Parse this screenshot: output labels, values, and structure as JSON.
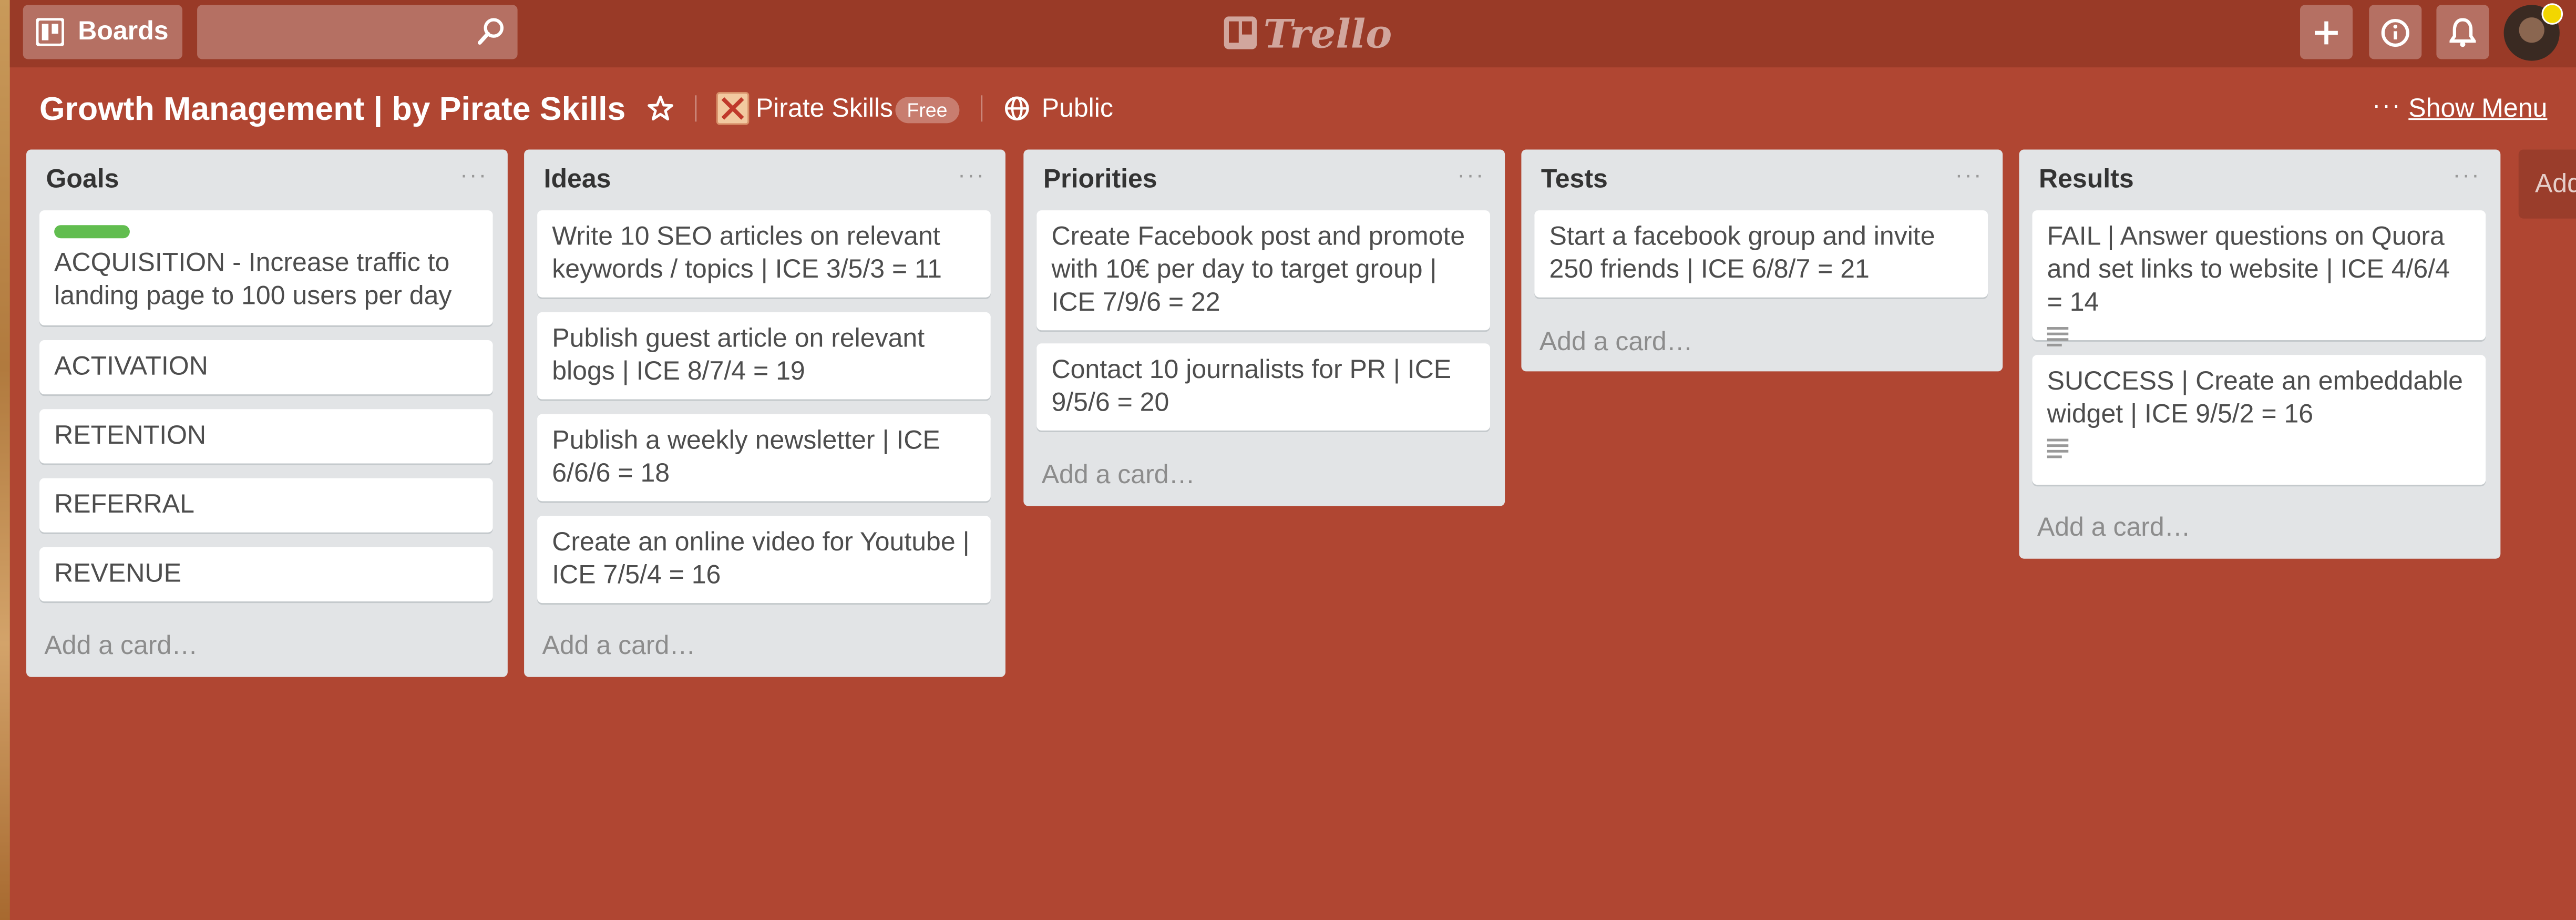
{
  "header": {
    "boards_label": "Boards",
    "search_placeholder": "",
    "logo_text": "Trello"
  },
  "board": {
    "title": "Growth Management | by Pirate Skills",
    "team": "Pirate Skills",
    "team_badge": "Free",
    "visibility": "Public",
    "menu_dots": "···",
    "show_menu": "Show Menu",
    "add_list": "Add"
  },
  "lists": [
    {
      "title": "Goals",
      "cards": [
        {
          "text": "ACQUISITION - Increase traffic to landing page to 100 users per day",
          "label_color": "#61bd4f"
        },
        {
          "text": "ACTIVATION"
        },
        {
          "text": "RETENTION"
        },
        {
          "text": "REFERRAL"
        },
        {
          "text": "REVENUE"
        }
      ],
      "add_card": "Add a card…"
    },
    {
      "title": "Ideas",
      "cards": [
        {
          "text": "Write 10 SEO articles on relevant keywords / topics | ICE 3/5/3 = 11"
        },
        {
          "text": "Publish guest article on relevant blogs | ICE 8/7/4 = 19"
        },
        {
          "text": "Publish a weekly newsletter | ICE 6/6/6 = 18"
        },
        {
          "text": "Create an online video for Youtube | ICE 7/5/4 = 16"
        }
      ],
      "add_card": "Add a card…"
    },
    {
      "title": "Priorities",
      "cards": [
        {
          "text": "Create Facebook post and promote with 10€ per day to target group | ICE 7/9/6 = 22"
        },
        {
          "text": "Contact 10 journalists for PR | ICE 9/5/6 = 20"
        }
      ],
      "add_card": "Add a card…"
    },
    {
      "title": "Tests",
      "cards": [
        {
          "text": "Start a facebook group and invite 250 friends | ICE 6/8/7 = 21"
        }
      ],
      "add_card": "Add a card…"
    },
    {
      "title": "Results",
      "cards": [
        {
          "text": "FAIL | Answer questions on Quora and set links to website | ICE 4/6/4 = 14",
          "has_description": true
        },
        {
          "text": "SUCCESS | Create an embeddable widget | ICE 9/5/2 = 16",
          "has_description": true
        }
      ],
      "add_card": "Add a card…"
    }
  ],
  "list_menu_glyph": "···",
  "colors": {
    "board_background": "#b04632",
    "header": "#993a27",
    "list_background": "#e2e4e6",
    "card_background": "#ffffff",
    "label_green": "#61bd4f"
  },
  "icons": [
    "boards-icon",
    "search-icon",
    "trello-logo-icon",
    "plus-icon",
    "info-icon",
    "bell-icon",
    "star-icon",
    "globe-icon",
    "description-icon"
  ]
}
